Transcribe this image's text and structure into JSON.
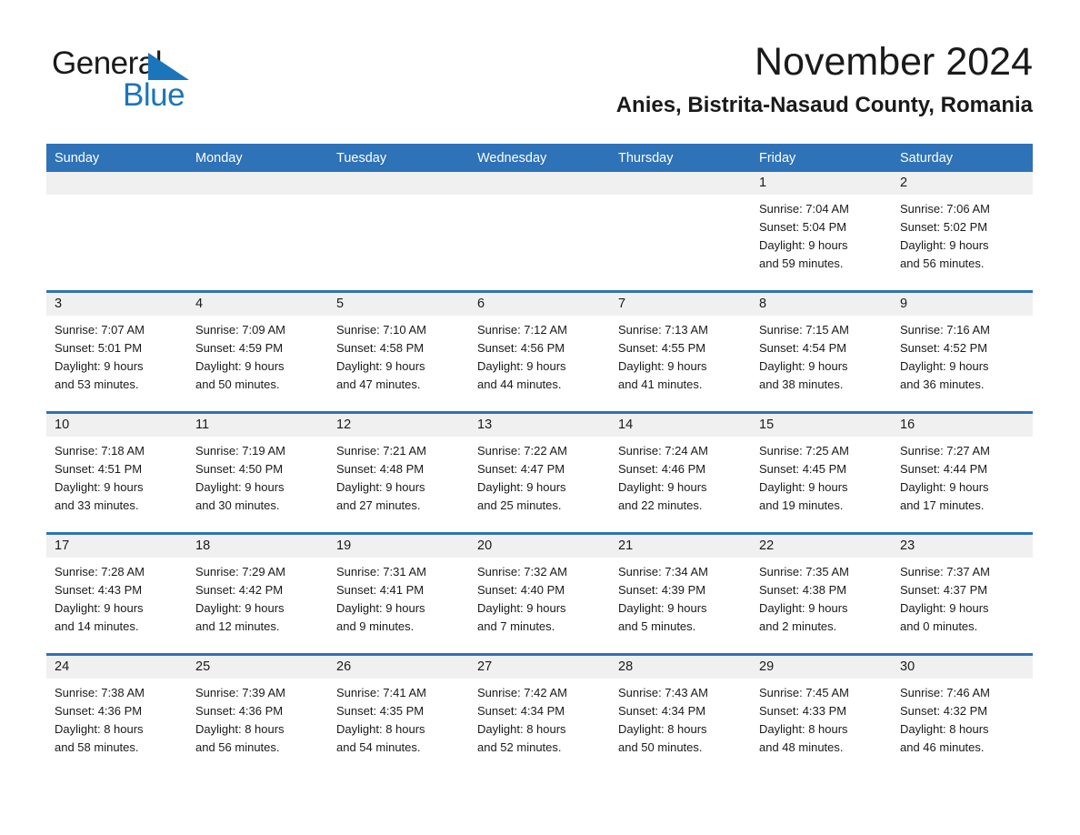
{
  "brand": {
    "line1": "General",
    "line2": "Blue",
    "triangle_color": "#1b75bb"
  },
  "header": {
    "month_title": "November 2024",
    "location": "Anies, Bistrita-Nasaud County, Romania"
  },
  "theme": {
    "header_blue": "#2e72b8",
    "daynum_gray": "#f0f0f0",
    "text": "#1a1a1a",
    "brand_blue": "#1b75bb"
  },
  "weekday_headers": [
    "Sunday",
    "Monday",
    "Tuesday",
    "Wednesday",
    "Thursday",
    "Friday",
    "Saturday"
  ],
  "weeks": [
    [
      {
        "day": "",
        "sunrise": "",
        "sunset": "",
        "daylight1": "",
        "daylight2": ""
      },
      {
        "day": "",
        "sunrise": "",
        "sunset": "",
        "daylight1": "",
        "daylight2": ""
      },
      {
        "day": "",
        "sunrise": "",
        "sunset": "",
        "daylight1": "",
        "daylight2": ""
      },
      {
        "day": "",
        "sunrise": "",
        "sunset": "",
        "daylight1": "",
        "daylight2": ""
      },
      {
        "day": "",
        "sunrise": "",
        "sunset": "",
        "daylight1": "",
        "daylight2": ""
      },
      {
        "day": "1",
        "sunrise": "Sunrise: 7:04 AM",
        "sunset": "Sunset: 5:04 PM",
        "daylight1": "Daylight: 9 hours",
        "daylight2": "and 59 minutes."
      },
      {
        "day": "2",
        "sunrise": "Sunrise: 7:06 AM",
        "sunset": "Sunset: 5:02 PM",
        "daylight1": "Daylight: 9 hours",
        "daylight2": "and 56 minutes."
      }
    ],
    [
      {
        "day": "3",
        "sunrise": "Sunrise: 7:07 AM",
        "sunset": "Sunset: 5:01 PM",
        "daylight1": "Daylight: 9 hours",
        "daylight2": "and 53 minutes."
      },
      {
        "day": "4",
        "sunrise": "Sunrise: 7:09 AM",
        "sunset": "Sunset: 4:59 PM",
        "daylight1": "Daylight: 9 hours",
        "daylight2": "and 50 minutes."
      },
      {
        "day": "5",
        "sunrise": "Sunrise: 7:10 AM",
        "sunset": "Sunset: 4:58 PM",
        "daylight1": "Daylight: 9 hours",
        "daylight2": "and 47 minutes."
      },
      {
        "day": "6",
        "sunrise": "Sunrise: 7:12 AM",
        "sunset": "Sunset: 4:56 PM",
        "daylight1": "Daylight: 9 hours",
        "daylight2": "and 44 minutes."
      },
      {
        "day": "7",
        "sunrise": "Sunrise: 7:13 AM",
        "sunset": "Sunset: 4:55 PM",
        "daylight1": "Daylight: 9 hours",
        "daylight2": "and 41 minutes."
      },
      {
        "day": "8",
        "sunrise": "Sunrise: 7:15 AM",
        "sunset": "Sunset: 4:54 PM",
        "daylight1": "Daylight: 9 hours",
        "daylight2": "and 38 minutes."
      },
      {
        "day": "9",
        "sunrise": "Sunrise: 7:16 AM",
        "sunset": "Sunset: 4:52 PM",
        "daylight1": "Daylight: 9 hours",
        "daylight2": "and 36 minutes."
      }
    ],
    [
      {
        "day": "10",
        "sunrise": "Sunrise: 7:18 AM",
        "sunset": "Sunset: 4:51 PM",
        "daylight1": "Daylight: 9 hours",
        "daylight2": "and 33 minutes."
      },
      {
        "day": "11",
        "sunrise": "Sunrise: 7:19 AM",
        "sunset": "Sunset: 4:50 PM",
        "daylight1": "Daylight: 9 hours",
        "daylight2": "and 30 minutes."
      },
      {
        "day": "12",
        "sunrise": "Sunrise: 7:21 AM",
        "sunset": "Sunset: 4:48 PM",
        "daylight1": "Daylight: 9 hours",
        "daylight2": "and 27 minutes."
      },
      {
        "day": "13",
        "sunrise": "Sunrise: 7:22 AM",
        "sunset": "Sunset: 4:47 PM",
        "daylight1": "Daylight: 9 hours",
        "daylight2": "and 25 minutes."
      },
      {
        "day": "14",
        "sunrise": "Sunrise: 7:24 AM",
        "sunset": "Sunset: 4:46 PM",
        "daylight1": "Daylight: 9 hours",
        "daylight2": "and 22 minutes."
      },
      {
        "day": "15",
        "sunrise": "Sunrise: 7:25 AM",
        "sunset": "Sunset: 4:45 PM",
        "daylight1": "Daylight: 9 hours",
        "daylight2": "and 19 minutes."
      },
      {
        "day": "16",
        "sunrise": "Sunrise: 7:27 AM",
        "sunset": "Sunset: 4:44 PM",
        "daylight1": "Daylight: 9 hours",
        "daylight2": "and 17 minutes."
      }
    ],
    [
      {
        "day": "17",
        "sunrise": "Sunrise: 7:28 AM",
        "sunset": "Sunset: 4:43 PM",
        "daylight1": "Daylight: 9 hours",
        "daylight2": "and 14 minutes."
      },
      {
        "day": "18",
        "sunrise": "Sunrise: 7:29 AM",
        "sunset": "Sunset: 4:42 PM",
        "daylight1": "Daylight: 9 hours",
        "daylight2": "and 12 minutes."
      },
      {
        "day": "19",
        "sunrise": "Sunrise: 7:31 AM",
        "sunset": "Sunset: 4:41 PM",
        "daylight1": "Daylight: 9 hours",
        "daylight2": "and 9 minutes."
      },
      {
        "day": "20",
        "sunrise": "Sunrise: 7:32 AM",
        "sunset": "Sunset: 4:40 PM",
        "daylight1": "Daylight: 9 hours",
        "daylight2": "and 7 minutes."
      },
      {
        "day": "21",
        "sunrise": "Sunrise: 7:34 AM",
        "sunset": "Sunset: 4:39 PM",
        "daylight1": "Daylight: 9 hours",
        "daylight2": "and 5 minutes."
      },
      {
        "day": "22",
        "sunrise": "Sunrise: 7:35 AM",
        "sunset": "Sunset: 4:38 PM",
        "daylight1": "Daylight: 9 hours",
        "daylight2": "and 2 minutes."
      },
      {
        "day": "23",
        "sunrise": "Sunrise: 7:37 AM",
        "sunset": "Sunset: 4:37 PM",
        "daylight1": "Daylight: 9 hours",
        "daylight2": "and 0 minutes."
      }
    ],
    [
      {
        "day": "24",
        "sunrise": "Sunrise: 7:38 AM",
        "sunset": "Sunset: 4:36 PM",
        "daylight1": "Daylight: 8 hours",
        "daylight2": "and 58 minutes."
      },
      {
        "day": "25",
        "sunrise": "Sunrise: 7:39 AM",
        "sunset": "Sunset: 4:36 PM",
        "daylight1": "Daylight: 8 hours",
        "daylight2": "and 56 minutes."
      },
      {
        "day": "26",
        "sunrise": "Sunrise: 7:41 AM",
        "sunset": "Sunset: 4:35 PM",
        "daylight1": "Daylight: 8 hours",
        "daylight2": "and 54 minutes."
      },
      {
        "day": "27",
        "sunrise": "Sunrise: 7:42 AM",
        "sunset": "Sunset: 4:34 PM",
        "daylight1": "Daylight: 8 hours",
        "daylight2": "and 52 minutes."
      },
      {
        "day": "28",
        "sunrise": "Sunrise: 7:43 AM",
        "sunset": "Sunset: 4:34 PM",
        "daylight1": "Daylight: 8 hours",
        "daylight2": "and 50 minutes."
      },
      {
        "day": "29",
        "sunrise": "Sunrise: 7:45 AM",
        "sunset": "Sunset: 4:33 PM",
        "daylight1": "Daylight: 8 hours",
        "daylight2": "and 48 minutes."
      },
      {
        "day": "30",
        "sunrise": "Sunrise: 7:46 AM",
        "sunset": "Sunset: 4:32 PM",
        "daylight1": "Daylight: 8 hours",
        "daylight2": "and 46 minutes."
      }
    ]
  ]
}
